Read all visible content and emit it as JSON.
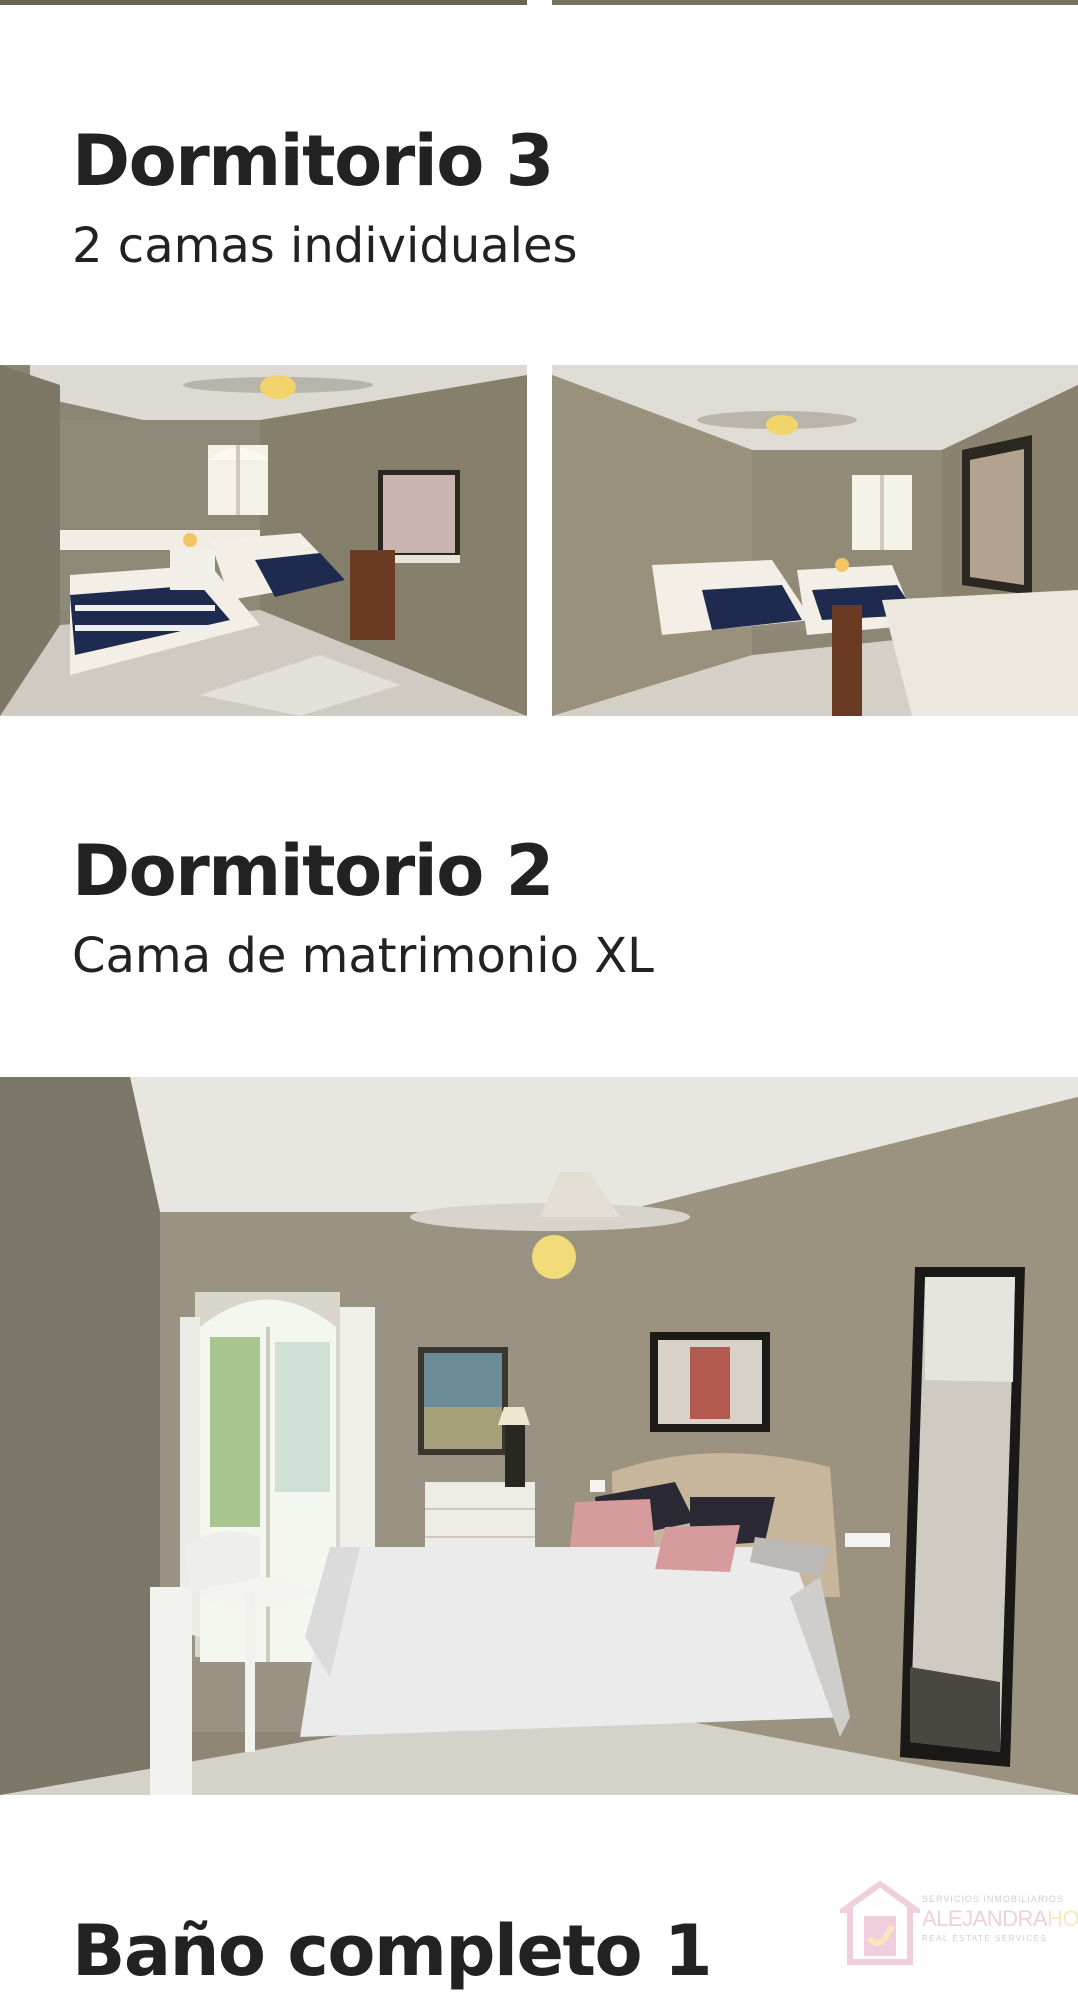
{
  "sections": [
    {
      "title": "Dormitorio 3",
      "subtitle": "2 camas individuales"
    },
    {
      "title": "Dormitorio 2",
      "subtitle": "Cama de matrimonio XL"
    },
    {
      "title": "Baño completo 1"
    }
  ],
  "watermark": {
    "top_line": "SERVICIOS INMOBILIARIOS",
    "brand_a": "ALEJANDRA",
    "brand_b": "HOME",
    "bottom_line": "REAL ESTATE SERVICES"
  },
  "colors": {
    "text": "#222222",
    "background": "#ffffff",
    "watermark_pink": "#e7a7c4",
    "watermark_gold": "#f3d28c"
  }
}
